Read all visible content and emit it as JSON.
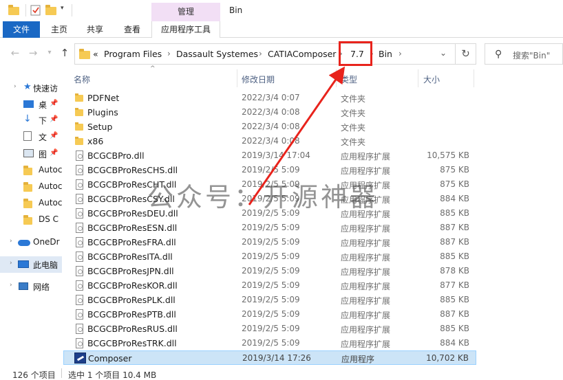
{
  "window": {
    "title": "Bin",
    "manage_tab": "管理"
  },
  "ribbon": {
    "tabs": [
      "文件",
      "主页",
      "共享",
      "查看",
      "应用程序工具"
    ]
  },
  "address": {
    "prefix": "«",
    "crumbs": [
      "Program Files",
      "Dassault Systemes",
      "CATIAComposer",
      "7.7",
      "Bin"
    ],
    "separator": "›"
  },
  "search": {
    "placeholder": "搜索\"Bin\""
  },
  "nav": {
    "items": [
      {
        "label": "快速访",
        "icon": "star-icon"
      },
      {
        "label": "桌",
        "icon": "desktop-icon"
      },
      {
        "label": "下",
        "icon": "download-icon"
      },
      {
        "label": "文",
        "icon": "document-icon"
      },
      {
        "label": "图",
        "icon": "picture-icon"
      },
      {
        "label": "Autoc",
        "icon": "folder-icon"
      },
      {
        "label": "Autoc",
        "icon": "folder-icon"
      },
      {
        "label": "Autoc",
        "icon": "folder-icon"
      },
      {
        "label": "DS C",
        "icon": "folder-icon"
      },
      {
        "label": "OneDr",
        "icon": "cloud-icon"
      },
      {
        "label": "此电脑",
        "icon": "computer-icon"
      },
      {
        "label": "网络",
        "icon": "network-icon"
      }
    ]
  },
  "columns": {
    "name": "名称",
    "date": "修改日期",
    "type": "类型",
    "size": "大小"
  },
  "files": [
    {
      "name": "PDFNet",
      "date": "2022/3/4 0:07",
      "type": "文件夹",
      "size": "",
      "kind": "folder"
    },
    {
      "name": "Plugins",
      "date": "2022/3/4 0:08",
      "type": "文件夹",
      "size": "",
      "kind": "folder"
    },
    {
      "name": "Setup",
      "date": "2022/3/4 0:08",
      "type": "文件夹",
      "size": "",
      "kind": "folder"
    },
    {
      "name": "x86",
      "date": "2022/3/4 0:08",
      "type": "文件夹",
      "size": "",
      "kind": "folder"
    },
    {
      "name": "BCGCBPro.dll",
      "date": "2019/3/14 17:04",
      "type": "应用程序扩展",
      "size": "10,575 KB",
      "kind": "dll"
    },
    {
      "name": "BCGCBProResCHS.dll",
      "date": "2019/2/5 5:09",
      "type": "应用程序扩展",
      "size": "875 KB",
      "kind": "dll"
    },
    {
      "name": "BCGCBProResCHT.dll",
      "date": "2019/2/5 5:09",
      "type": "应用程序扩展",
      "size": "875 KB",
      "kind": "dll"
    },
    {
      "name": "BCGCBProResCSY.dll",
      "date": "2019/2/5 5:09",
      "type": "应用程序扩展",
      "size": "884 KB",
      "kind": "dll"
    },
    {
      "name": "BCGCBProResDEU.dll",
      "date": "2019/2/5 5:09",
      "type": "应用程序扩展",
      "size": "885 KB",
      "kind": "dll"
    },
    {
      "name": "BCGCBProResESN.dll",
      "date": "2019/2/5 5:09",
      "type": "应用程序扩展",
      "size": "887 KB",
      "kind": "dll"
    },
    {
      "name": "BCGCBProResFRA.dll",
      "date": "2019/2/5 5:09",
      "type": "应用程序扩展",
      "size": "887 KB",
      "kind": "dll"
    },
    {
      "name": "BCGCBProResITA.dll",
      "date": "2019/2/5 5:09",
      "type": "应用程序扩展",
      "size": "885 KB",
      "kind": "dll"
    },
    {
      "name": "BCGCBProResJPN.dll",
      "date": "2019/2/5 5:09",
      "type": "应用程序扩展",
      "size": "878 KB",
      "kind": "dll"
    },
    {
      "name": "BCGCBProResKOR.dll",
      "date": "2019/2/5 5:09",
      "type": "应用程序扩展",
      "size": "877 KB",
      "kind": "dll"
    },
    {
      "name": "BCGCBProResPLK.dll",
      "date": "2019/2/5 5:09",
      "type": "应用程序扩展",
      "size": "885 KB",
      "kind": "dll"
    },
    {
      "name": "BCGCBProResPTB.dll",
      "date": "2019/2/5 5:09",
      "type": "应用程序扩展",
      "size": "887 KB",
      "kind": "dll"
    },
    {
      "name": "BCGCBProResRUS.dll",
      "date": "2019/2/5 5:09",
      "type": "应用程序扩展",
      "size": "885 KB",
      "kind": "dll"
    },
    {
      "name": "BCGCBProResTRK.dll",
      "date": "2019/2/5 5:09",
      "type": "应用程序扩展",
      "size": "884 KB",
      "kind": "dll"
    },
    {
      "name": "Composer",
      "date": "2019/3/14 17:26",
      "type": "应用程序",
      "size": "10,702 KB",
      "kind": "app",
      "selected": true
    }
  ],
  "status": {
    "count": "126 个项目",
    "selected": "选中 1 个项目  10.4 MB"
  },
  "watermark": "公众号：开源神器",
  "colors": {
    "accent": "#1a68c4",
    "manage_tab": "#f2dff5",
    "highlight": "#e8231c",
    "selection": "#cce4f7"
  }
}
